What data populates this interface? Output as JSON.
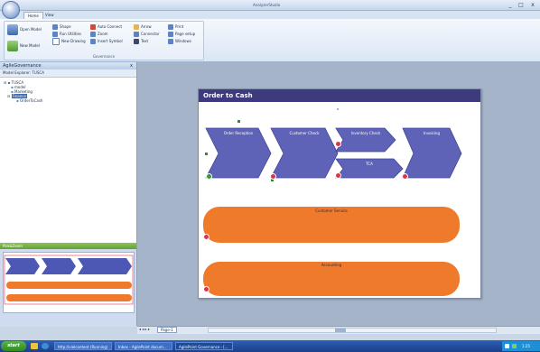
{
  "window": {
    "title": "AnalyzerStudio",
    "controls": [
      "_",
      "□",
      "x"
    ]
  },
  "ribbon": {
    "tabs": [
      "Home",
      "View"
    ],
    "active_tab": "Home",
    "open_model": "Open Model",
    "new_model": "New Model",
    "col2": [
      "Shape",
      "Run Utilities",
      "New Drawing"
    ],
    "col3": [
      "Auto Connect",
      "Zoom",
      "Insert Symbol"
    ],
    "col4": [
      "Arrow",
      "Connector",
      "Text"
    ],
    "col5": [
      "Print",
      "Page setup",
      "Windows"
    ],
    "group_label": "Governance"
  },
  "left_pane": {
    "title": "AgileGovernance",
    "close": "x",
    "model_explorer": "Model Explorer: TUSCA",
    "tree": [
      "TUSCA",
      "model",
      "Marketing",
      "Finance",
      "OrderToCash"
    ],
    "outline_title": "Pan&Zoom"
  },
  "diagram": {
    "title": "Order to Cash",
    "processes": [
      "Order Reception",
      "Customer Check",
      "Inventory Check",
      "Invoicing",
      "TCA"
    ],
    "bands": [
      "Customer Service",
      "Accounting"
    ]
  },
  "status": {
    "page_tab": "Page-1"
  },
  "taskbar": {
    "start": "start",
    "buttons": [
      "http://vielcontent (Running)",
      "Inbox - AgilePoint docum...",
      "AgilePoint Governance - [..."
    ],
    "clock": "1:25"
  },
  "colors": {
    "process_fill": "#5f63b8",
    "band_fill": "#f07a2c",
    "header_bg": "#3d3a7e",
    "error_badge": "#d9364a"
  }
}
